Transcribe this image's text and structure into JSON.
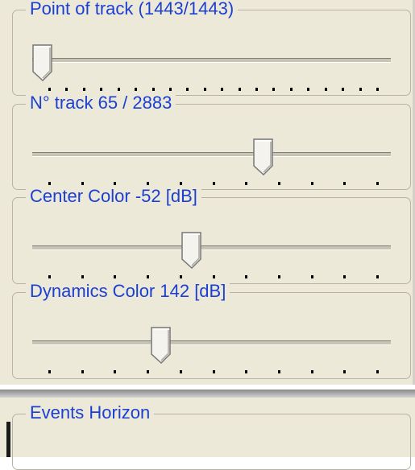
{
  "sliders": [
    {
      "label": "Point of track (1443/1443)",
      "value_fraction": 0.0,
      "tick_count": 20
    },
    {
      "label": "N° track 65 / 2883",
      "value_fraction": 0.65,
      "tick_count": 11
    },
    {
      "label": "Center Color -52 [dB]",
      "value_fraction": 0.44,
      "tick_count": 11
    },
    {
      "label": "Dynamics Color 142 [dB]",
      "value_fraction": 0.35,
      "tick_count": 11
    }
  ],
  "events_group": {
    "label": "Events Horizon"
  }
}
